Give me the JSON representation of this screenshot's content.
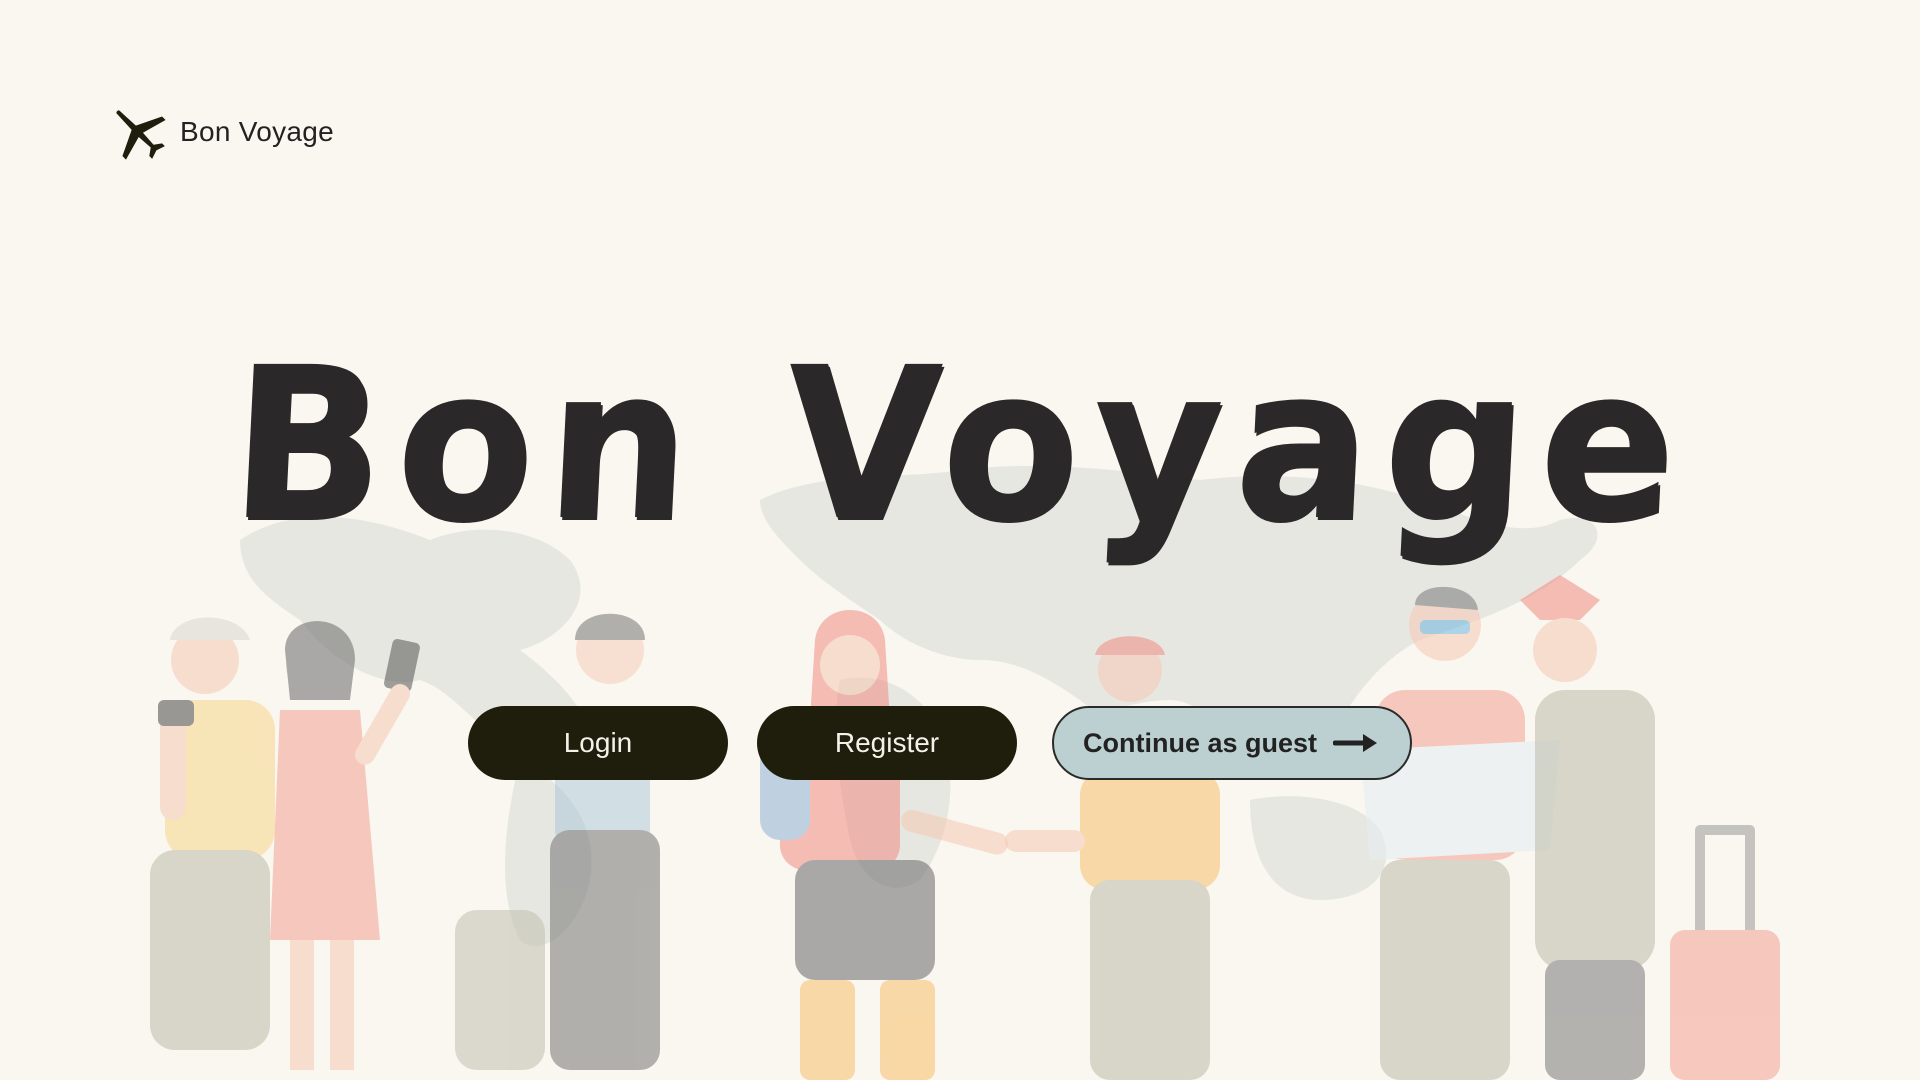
{
  "header": {
    "brand_name": "Bon Voyage",
    "logo_icon": "airplane-icon"
  },
  "hero": {
    "title": "Bon Voyage"
  },
  "actions": {
    "login_label": "Login",
    "register_label": "Register",
    "guest_label": "Continue as guest",
    "guest_icon": "arrow-right-icon"
  },
  "colors": {
    "background": "#faf6f0",
    "primary_button": "#1f1e0c",
    "guest_button": "#bcd0d1",
    "title": "#2b2829"
  }
}
